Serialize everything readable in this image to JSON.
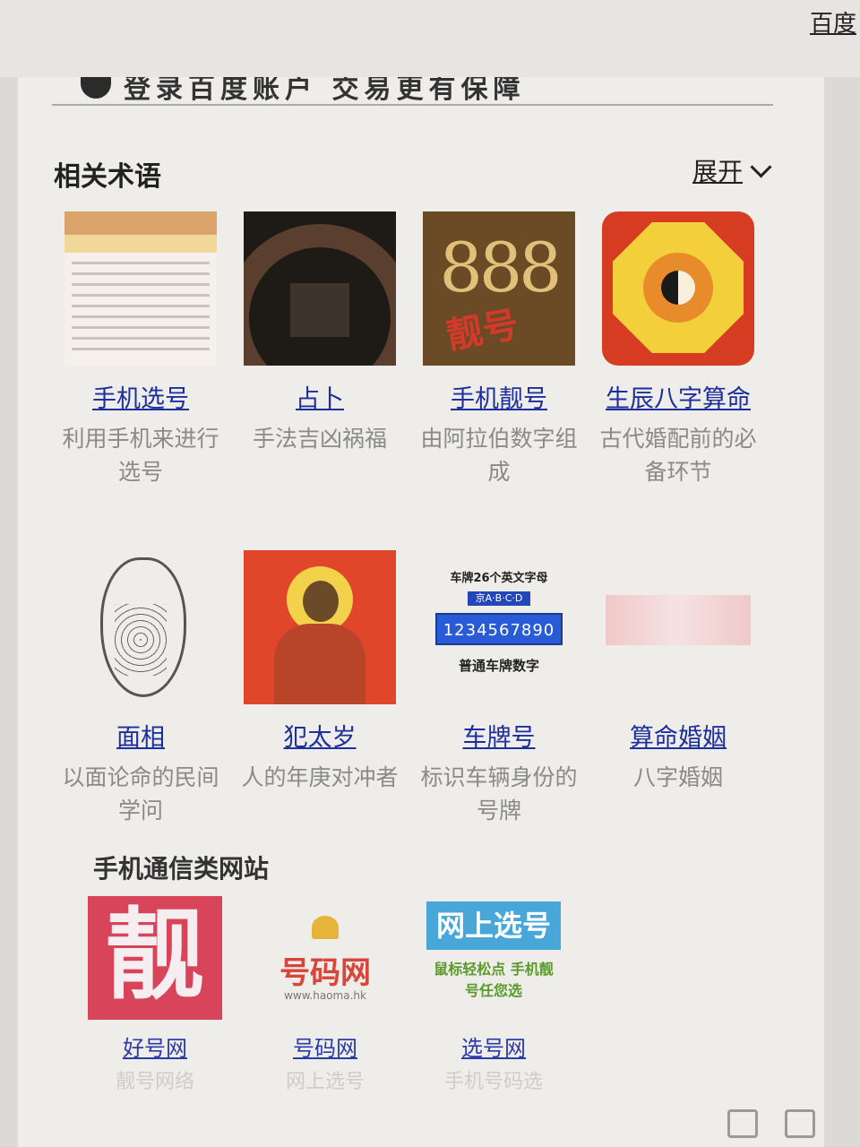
{
  "header": {
    "site_link": "百度"
  },
  "promo": {
    "text": "登录百度账户 交易更有保障"
  },
  "related": {
    "title": "相关术语",
    "expand_label": "展开",
    "items": [
      {
        "name": "手机选号",
        "desc": "利用手机来进行选号",
        "icon": "number-table-thumbnail"
      },
      {
        "name": "占卜",
        "desc": "手法吉凶祸福",
        "icon": "divination-thumbnail"
      },
      {
        "name": "手机靓号",
        "desc": "由阿拉伯数字组成",
        "icon": "888-thumbnail"
      },
      {
        "name": "生辰八字算命",
        "desc": "古代婚配前的必备环节",
        "icon": "bagua-thumbnail"
      },
      {
        "name": "面相",
        "desc": "以面论命的民间学问",
        "icon": "face-reading-thumbnail"
      },
      {
        "name": "犯太岁",
        "desc": "人的年庚对冲者",
        "icon": "taisui-thumbnail"
      },
      {
        "name": "车牌号",
        "desc": "标识车辆身份的号牌",
        "icon": "license-plate-thumbnail"
      },
      {
        "name": "算命婚姻",
        "desc": "八字婚姻",
        "icon": "marriage-thumbnail"
      }
    ],
    "plate": {
      "top": "车牌26个英文字母",
      "badge": "京A·B·C·D",
      "number": "1234567890",
      "bottom": "普通车牌数字"
    },
    "lucky": {
      "digits": "888",
      "script": "靓号"
    }
  },
  "sites": {
    "title": "手机通信类网站",
    "items": [
      {
        "name": "好号网",
        "desc": "靓号网络",
        "logo_text": "靓"
      },
      {
        "name": "号码网",
        "desc": "网上选号",
        "logo_text": "号码网",
        "logo_sub": "www.haoma.hk"
      },
      {
        "name": "选号网",
        "desc": "手机号码选",
        "logo_text": "网上选号",
        "logo_sub": "鼠标轻松点 手机靓号任您选"
      }
    ]
  },
  "colors": {
    "link": "#1c2f9a",
    "text": "#222222",
    "muted": "#8a8a86"
  }
}
